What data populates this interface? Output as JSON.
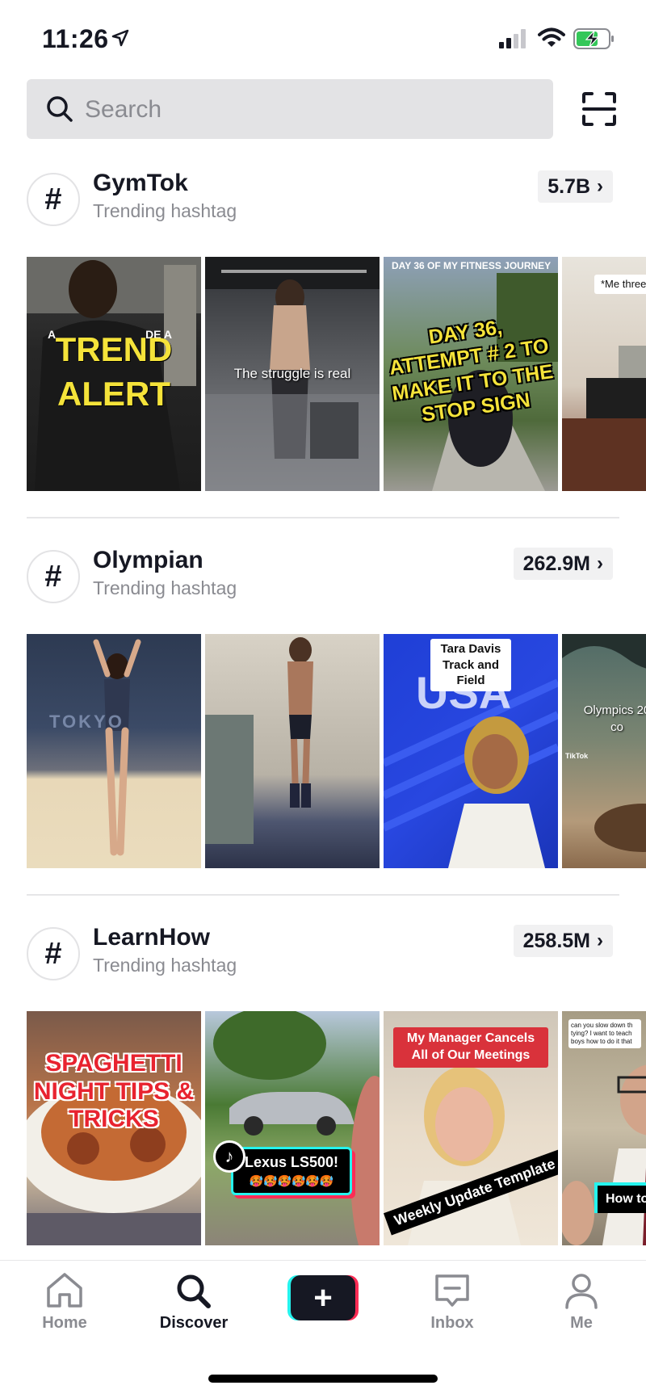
{
  "status": {
    "time": "11:26"
  },
  "search": {
    "placeholder": "Search"
  },
  "sections": [
    {
      "tag": "GymTok",
      "subtitle": "Trending hashtag",
      "count": "5.7B",
      "thumbs": [
        {
          "caption": "TREND ALERT",
          "shirt_text_left": "A",
          "shirt_text_right": "DE A"
        },
        {
          "caption": "The struggle is real"
        },
        {
          "caption_top": "DAY 36 OF MY FITNESS JOURNEY",
          "caption": "DAY 36, ATTEMPT # 2 TO MAKE IT TO THE STOP SIGN"
        },
        {
          "caption": "*Me three thinking liftin fem"
        }
      ]
    },
    {
      "tag": "Olympian",
      "subtitle": "Trending hashtag",
      "count": "262.9M",
      "thumbs": [
        {
          "caption": "TOKYO"
        },
        {
          "caption": ""
        },
        {
          "caption": "Tara Davis Track and Field",
          "wall_text": "USA"
        },
        {
          "caption": "Olympics 20 co",
          "watermark": "TikTok"
        }
      ]
    },
    {
      "tag": "LearnHow",
      "subtitle": "Trending hashtag",
      "count": "258.5M",
      "thumbs": [
        {
          "caption": "SPAGHETTI NIGHT TIPS & TRICKS"
        },
        {
          "caption": "Lexus LS500!",
          "emoji": "🥵🥵🥵🥵🥵🥵"
        },
        {
          "caption_top": "My Manager Cancels All of Our Meetings",
          "caption": "Weekly Update Template"
        },
        {
          "caption_top": "can you slow down th tying? I want to teach boys how to do it that",
          "caption": "How to"
        }
      ]
    }
  ],
  "nav": {
    "home": "Home",
    "discover": "Discover",
    "create": "+",
    "inbox": "Inbox",
    "me": "Me"
  },
  "colors": {
    "accent_cyan": "#25f4ee",
    "accent_red": "#fe2c55",
    "text_primary": "#161823",
    "text_secondary": "#8a8b91"
  },
  "icons": [
    "location-arrow-icon",
    "signal-icon",
    "wifi-icon",
    "battery-charging-icon",
    "search-icon",
    "scan-icon",
    "hashtag-icon",
    "chevron-right-icon",
    "home-icon",
    "discover-icon",
    "create-icon",
    "inbox-icon",
    "profile-icon"
  ]
}
